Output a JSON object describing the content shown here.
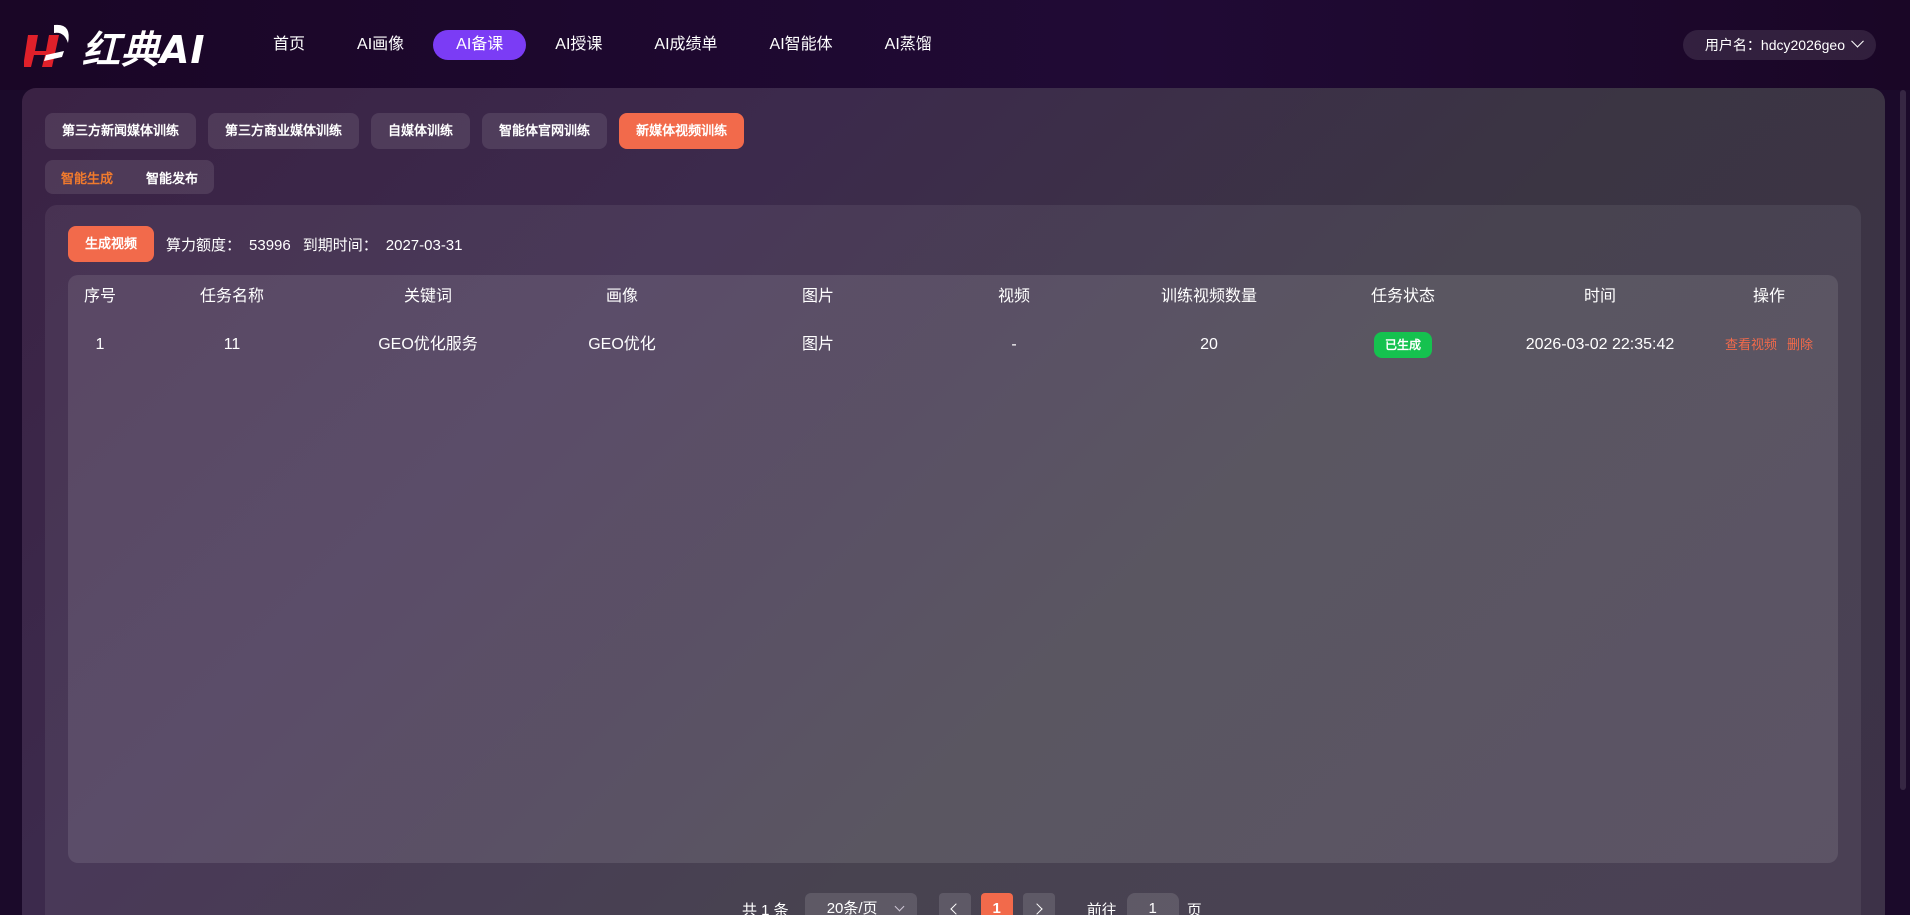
{
  "logo": {
    "text": "红典AI"
  },
  "nav": {
    "items": [
      "首页",
      "AI画像",
      "AI备课",
      "AI授课",
      "AI成绩单",
      "AI智能体",
      "AI蒸馏"
    ],
    "active_index": 2
  },
  "user": {
    "label": "用户名：hdcy2026geo"
  },
  "tabs_primary": [
    "第三方新闻媒体训练",
    "第三方商业媒体训练",
    "自媒体训练",
    "智能体官网训练",
    "新媒体视频训练"
  ],
  "tabs_primary_active": 4,
  "tabs_secondary": [
    "智能生成",
    "智能发布"
  ],
  "tabs_secondary_active": 0,
  "toolbar": {
    "generate_label": "生成视频",
    "quota_label": "算力额度：",
    "quota_value": "53996",
    "expire_label": "到期时间：",
    "expire_value": "2027-03-31"
  },
  "table": {
    "headers": [
      "序号",
      "任务名称",
      "关键词",
      "画像",
      "图片",
      "视频",
      "训练视频数量",
      "任务状态",
      "时间",
      "操作"
    ],
    "rows": [
      {
        "index": "1",
        "name": "11",
        "keyword": "GEO优化服务",
        "persona": "GEO优化",
        "image": "图片",
        "video": "-",
        "count": "20",
        "status": "已生成",
        "time": "2026-03-02 22:35:42",
        "op_view": "查看视频",
        "op_delete": "删除"
      }
    ]
  },
  "pagination": {
    "total": "共 1 条",
    "page_size": "20条/页",
    "current": "1",
    "goto_label": "前往",
    "goto_value": "1",
    "page_suffix": "页"
  },
  "colors": {
    "accent": "#f26a4b",
    "nav_active": "#7b3cf5",
    "status_ok": "#15c24f"
  }
}
